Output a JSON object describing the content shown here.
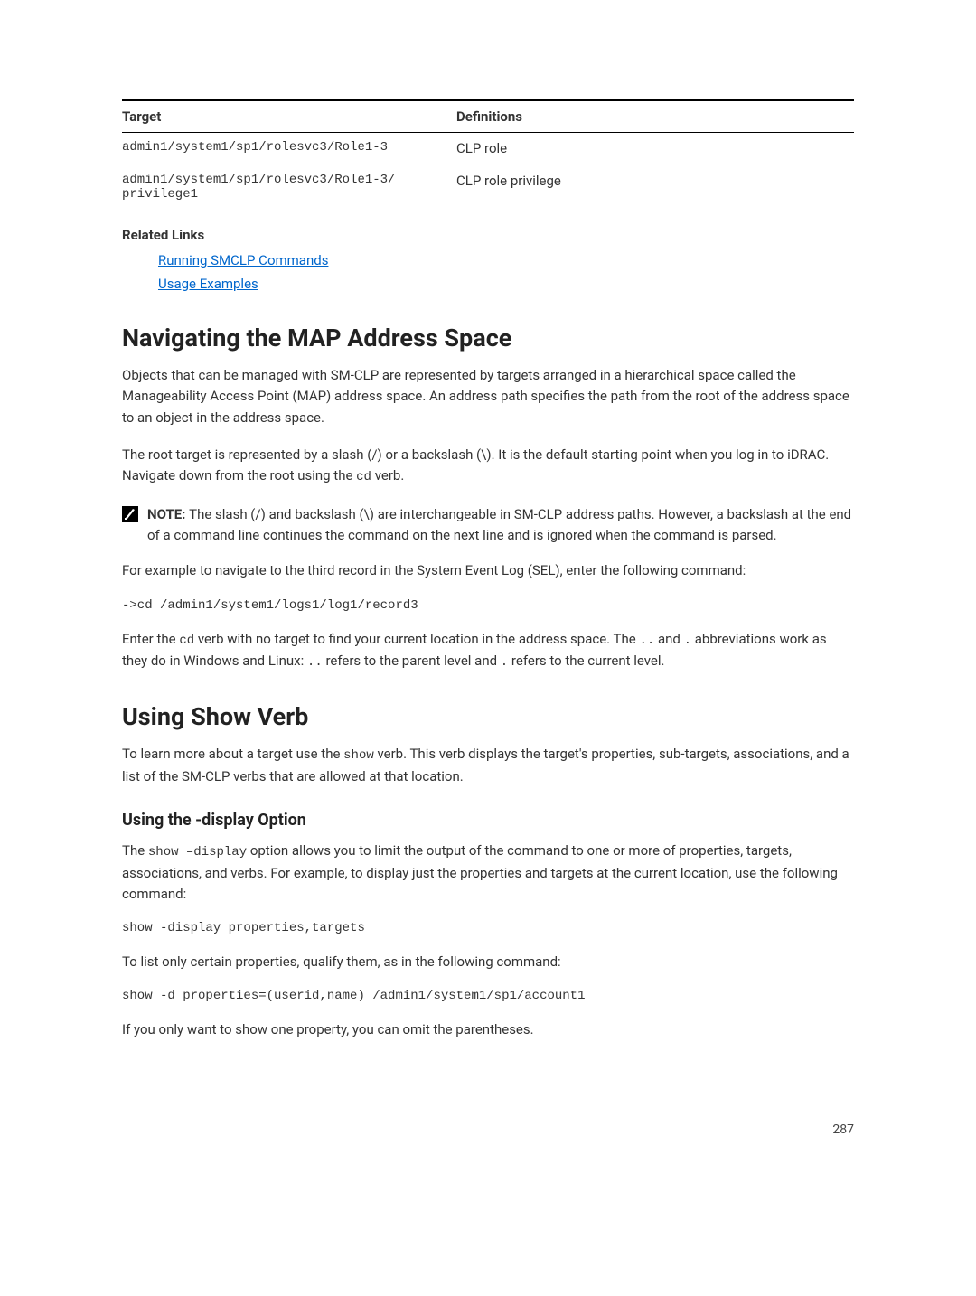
{
  "table": {
    "headers": {
      "target": "Target",
      "definitions": "Definitions"
    },
    "rows": [
      {
        "target": "admin1/system1/sp1/rolesvc3/Role1-3",
        "def": "CLP role"
      },
      {
        "target": "admin1/system1/sp1/rolesvc3/Role1-3/\nprivilege1",
        "def": "CLP role privilege"
      }
    ]
  },
  "related_links": {
    "heading": "Related Links",
    "items": [
      "Running SMCLP Commands",
      "Usage Examples"
    ]
  },
  "section_nav": {
    "heading": "Navigating the MAP Address Space",
    "p1": "Objects that can be managed with SM-CLP are represented by targets arranged in a hierarchical space called the Manageability Access Point (MAP) address space. An address path specifies the path from the root of the address space to an object in the address space.",
    "p2_a": "The root target is represented by a slash (/) or a backslash (\\). It is the default starting point when you log in to iDRAC. Navigate down from the root using the ",
    "p2_cd": "cd",
    "p2_b": " verb.",
    "note_label": "NOTE: ",
    "note_text": "The slash (/) and backslash (\\) are interchangeable in SM-CLP address paths. However, a backslash at the end of a command line continues the command on the next line and is ignored when the command is parsed.",
    "p3": "For example to navigate to the third record in the System Event Log (SEL), enter the following command:",
    "code1": "->cd /admin1/system1/logs1/log1/record3",
    "p4_a": "Enter the ",
    "p4_cd": "cd",
    "p4_b": " verb with no target to find your current location in the address space. The ",
    "p4_dots1": "..",
    "p4_c": " and ",
    "p4_dot": ".",
    "p4_d": " abbreviations work as they do in Windows and Linux: ",
    "p4_dots2": "..",
    "p4_e": " refers to the parent level and ",
    "p4_dot2": ".",
    "p4_f": " refers to the current level."
  },
  "section_show": {
    "heading": "Using Show Verb",
    "p1_a": "To learn more about a target use the ",
    "p1_show": "show",
    "p1_b": " verb. This verb displays the target's properties, sub-targets, associations, and a list of the SM-CLP verbs that are allowed at that location.",
    "sub_heading": "Using the -display Option",
    "p2_a": "The ",
    "p2_cmd": "show –display",
    "p2_b": " option allows you to limit the output of the command to one or more of properties, targets, associations, and verbs. For example, to display just the properties and targets at the current location, use the following command:",
    "code2": "show -display properties,targets",
    "p3": "To list only certain properties, qualify them, as in the following command:",
    "code3": "show -d properties=(userid,name) /admin1/system1/sp1/account1",
    "p4": "If you only want to show one property, you can omit the parentheses."
  },
  "page_number": "287"
}
